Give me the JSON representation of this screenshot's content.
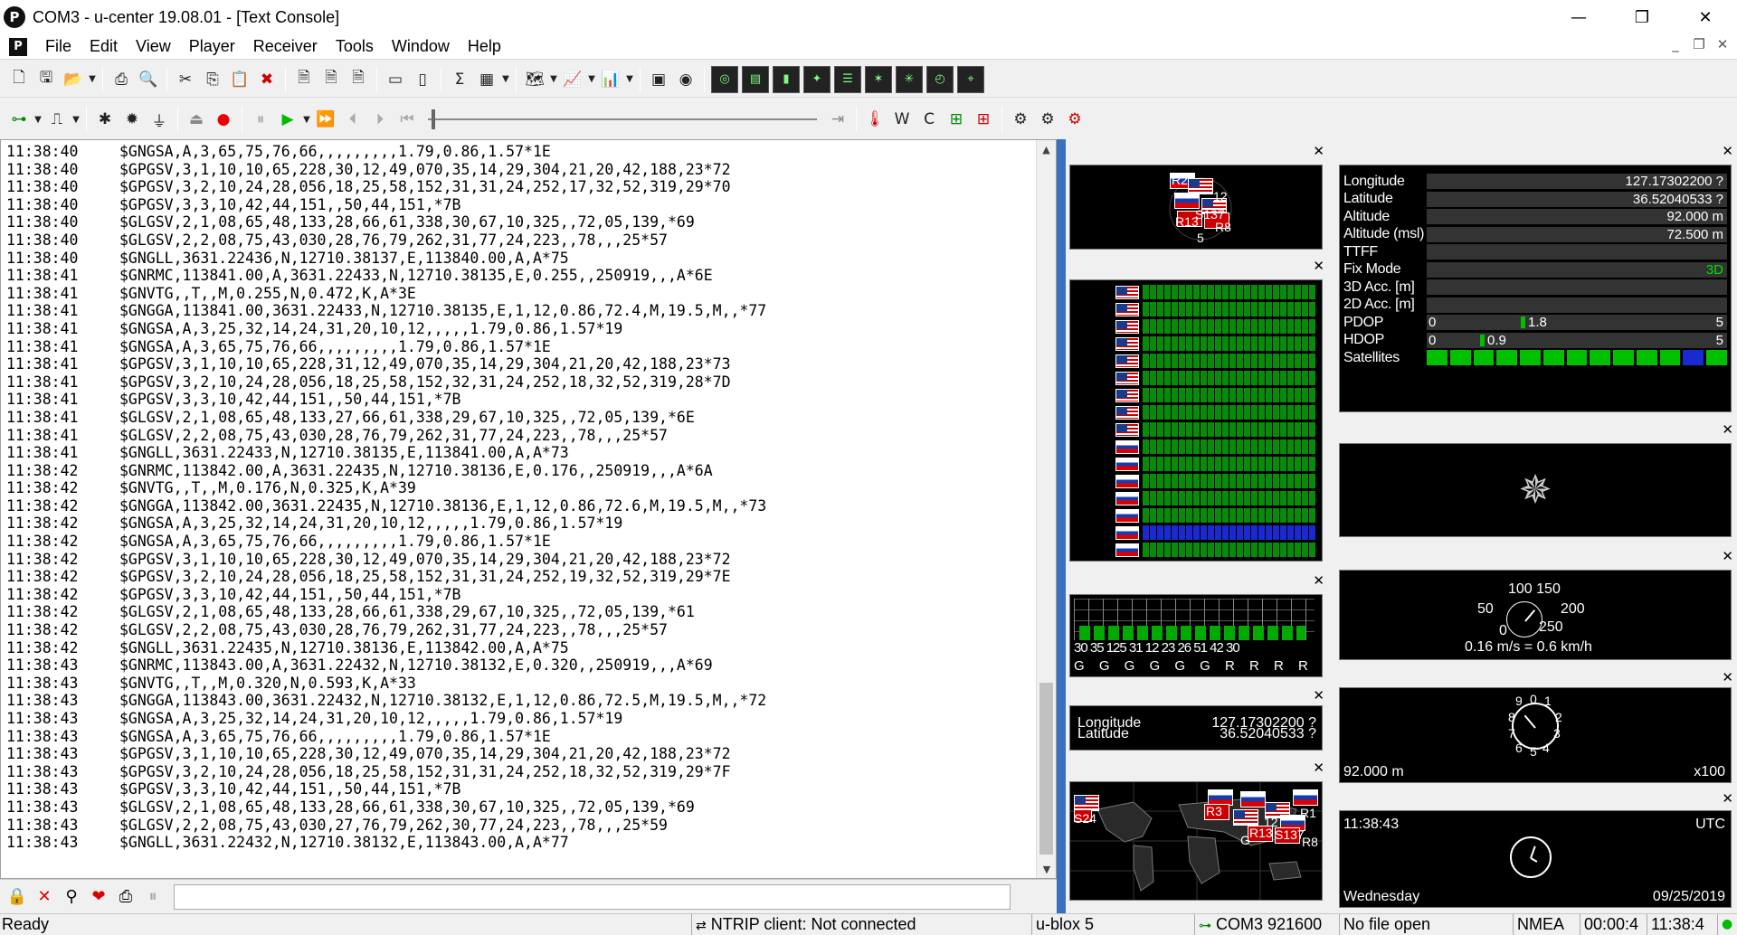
{
  "window": {
    "title": "COM3 - u-center 19.08.01 - [Text Console]",
    "app_icon": "P",
    "minimize": "—",
    "maximize": "❐",
    "close": "✕"
  },
  "menu": [
    "File",
    "Edit",
    "View",
    "Player",
    "Receiver",
    "Tools",
    "Window",
    "Help"
  ],
  "console": {
    "lines": [
      [
        "11:38:40",
        "$GNGSA,A,3,65,75,76,66,,,,,,,,,1.79,0.86,1.57*1E"
      ],
      [
        "11:38:40",
        "$GPGSV,3,1,10,10,65,228,30,12,49,070,35,14,29,304,21,20,42,188,23*72"
      ],
      [
        "11:38:40",
        "$GPGSV,3,2,10,24,28,056,18,25,58,152,31,31,24,252,17,32,52,319,29*70"
      ],
      [
        "11:38:40",
        "$GPGSV,3,3,10,42,44,151,,50,44,151,*7B"
      ],
      [
        "11:38:40",
        "$GLGSV,2,1,08,65,48,133,28,66,61,338,30,67,10,325,,72,05,139,*69"
      ],
      [
        "11:38:40",
        "$GLGSV,2,2,08,75,43,030,28,76,79,262,31,77,24,223,,78,,,25*57"
      ],
      [
        "11:38:40",
        "$GNGLL,3631.22436,N,12710.38137,E,113840.00,A,A*75"
      ],
      [
        "11:38:41",
        "$GNRMC,113841.00,A,3631.22433,N,12710.38135,E,0.255,,250919,,,A*6E"
      ],
      [
        "11:38:41",
        "$GNVTG,,T,,M,0.255,N,0.472,K,A*3E"
      ],
      [
        "11:38:41",
        "$GNGGA,113841.00,3631.22433,N,12710.38135,E,1,12,0.86,72.4,M,19.5,M,,*77"
      ],
      [
        "11:38:41",
        "$GNGSA,A,3,25,32,14,24,31,20,10,12,,,,,1.79,0.86,1.57*19"
      ],
      [
        "11:38:41",
        "$GNGSA,A,3,65,75,76,66,,,,,,,,,1.79,0.86,1.57*1E"
      ],
      [
        "11:38:41",
        "$GPGSV,3,1,10,10,65,228,31,12,49,070,35,14,29,304,21,20,42,188,23*73"
      ],
      [
        "11:38:41",
        "$GPGSV,3,2,10,24,28,056,18,25,58,152,32,31,24,252,18,32,52,319,28*7D"
      ],
      [
        "11:38:41",
        "$GPGSV,3,3,10,42,44,151,,50,44,151,*7B"
      ],
      [
        "11:38:41",
        "$GLGSV,2,1,08,65,48,133,27,66,61,338,29,67,10,325,,72,05,139,*6E"
      ],
      [
        "11:38:41",
        "$GLGSV,2,2,08,75,43,030,28,76,79,262,31,77,24,223,,78,,,25*57"
      ],
      [
        "11:38:41",
        "$GNGLL,3631.22433,N,12710.38135,E,113841.00,A,A*73"
      ],
      [
        "11:38:42",
        "$GNRMC,113842.00,A,3631.22435,N,12710.38136,E,0.176,,250919,,,A*6A"
      ],
      [
        "11:38:42",
        "$GNVTG,,T,,M,0.176,N,0.325,K,A*39"
      ],
      [
        "11:38:42",
        "$GNGGA,113842.00,3631.22435,N,12710.38136,E,1,12,0.86,72.6,M,19.5,M,,*73"
      ],
      [
        "11:38:42",
        "$GNGSA,A,3,25,32,14,24,31,20,10,12,,,,,1.79,0.86,1.57*19"
      ],
      [
        "11:38:42",
        "$GNGSA,A,3,65,75,76,66,,,,,,,,,1.79,0.86,1.57*1E"
      ],
      [
        "11:38:42",
        "$GPGSV,3,1,10,10,65,228,30,12,49,070,35,14,29,304,21,20,42,188,23*72"
      ],
      [
        "11:38:42",
        "$GPGSV,3,2,10,24,28,056,18,25,58,152,31,31,24,252,19,32,52,319,29*7E"
      ],
      [
        "11:38:42",
        "$GPGSV,3,3,10,42,44,151,,50,44,151,*7B"
      ],
      [
        "11:38:42",
        "$GLGSV,2,1,08,65,48,133,28,66,61,338,29,67,10,325,,72,05,139,*61"
      ],
      [
        "11:38:42",
        "$GLGSV,2,2,08,75,43,030,28,76,79,262,31,77,24,223,,78,,,25*57"
      ],
      [
        "11:38:42",
        "$GNGLL,3631.22435,N,12710.38136,E,113842.00,A,A*75"
      ],
      [
        "11:38:43",
        "$GNRMC,113843.00,A,3631.22432,N,12710.38132,E,0.320,,250919,,,A*69"
      ],
      [
        "11:38:43",
        "$GNVTG,,T,,M,0.320,N,0.593,K,A*33"
      ],
      [
        "11:38:43",
        "$GNGGA,113843.00,3631.22432,N,12710.38132,E,1,12,0.86,72.5,M,19.5,M,,*72"
      ],
      [
        "11:38:43",
        "$GNGSA,A,3,25,32,14,24,31,20,10,12,,,,,1.79,0.86,1.57*19"
      ],
      [
        "11:38:43",
        "$GNGSA,A,3,65,75,76,66,,,,,,,,,1.79,0.86,1.57*1E"
      ],
      [
        "11:38:43",
        "$GPGSV,3,1,10,10,65,228,30,12,49,070,35,14,29,304,21,20,42,188,23*72"
      ],
      [
        "11:38:43",
        "$GPGSV,3,2,10,24,28,056,18,25,58,152,31,31,24,252,18,32,52,319,29*7F"
      ],
      [
        "11:38:43",
        "$GPGSV,3,3,10,42,44,151,,50,44,151,*7B"
      ],
      [
        "11:38:43",
        "$GLGSV,2,1,08,65,48,133,28,66,61,338,30,67,10,325,,72,05,139,*69"
      ],
      [
        "11:38:43",
        "$GLGSV,2,2,08,75,43,030,27,76,79,262,30,77,24,223,,78,,,25*59"
      ],
      [
        "11:38:43",
        "$GNGLL,3631.22432,N,12710.38132,E,113843.00,A,A*77"
      ]
    ]
  },
  "skyplot": {
    "labels": [
      "R2",
      "R13",
      "S137",
      "R8",
      "12",
      "5"
    ]
  },
  "data_view": {
    "rows": [
      {
        "label": "Longitude",
        "value": "127.17302200 ?"
      },
      {
        "label": "Latitude",
        "value": "36.52040533 ?"
      },
      {
        "label": "Altitude",
        "value": "92.000 m"
      },
      {
        "label": "Altitude (msl)",
        "value": "72.500 m"
      },
      {
        "label": "TTFF",
        "value": ""
      },
      {
        "label": "Fix Mode",
        "value": "3D"
      }
    ],
    "acc3d_label": "3D Acc. [m]",
    "acc2d_label": "2D Acc. [m]",
    "pdop": {
      "label": "PDOP",
      "min": "0",
      "value": "1.8",
      "max": "5",
      "level": 0.36
    },
    "hdop": {
      "label": "HDOP",
      "min": "0",
      "value": "0.9",
      "max": "5",
      "level": 0.18
    },
    "satellites_label": "Satellites",
    "accent_green": "#00c000"
  },
  "small_lonlat": {
    "lon_label": "Longitude",
    "lat_label": "Latitude",
    "lon": "127.17302200 ?",
    "lat": "36.52040533 ?"
  },
  "small_signal": {
    "ids": "30 35 125 31 12 23 26 51 42 30",
    "systems": "G G G G G G R R R R"
  },
  "world_map": {
    "labels": [
      "R3",
      "R13",
      "S137",
      "R8",
      "R1",
      "12",
      "S24",
      "G"
    ]
  },
  "speed": {
    "ticks_top": "100 150",
    "t50": "50",
    "t200": "200",
    "t0": "0",
    "t250": "250",
    "readout": "0.16 m/s = 0.6 km/h"
  },
  "altimeter": {
    "value": "92.000 m",
    "scale": "x100",
    "digits": [
      "0",
      "1",
      "2",
      "3",
      "4",
      "5",
      "6",
      "7",
      "8",
      "9"
    ]
  },
  "clock": {
    "time": "11:38:43",
    "zone": "UTC",
    "day": "Wednesday",
    "date": "09/25/2019"
  },
  "status": {
    "ready": "Ready",
    "ntrip": "NTRIP client: Not connected",
    "receiver": "u-blox 5",
    "port": "COM3 921600",
    "file": "No file open",
    "protocol": "NMEA",
    "elapsed": "00:00:4",
    "time": "11:38:4"
  }
}
